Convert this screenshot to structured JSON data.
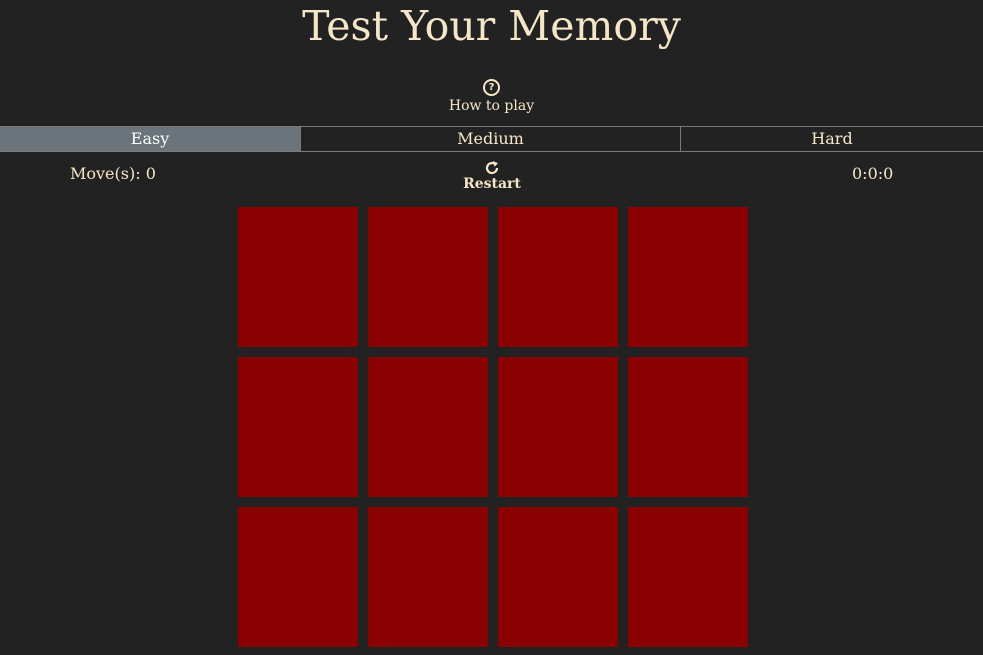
{
  "title": "Test Your Memory",
  "how_to_play": {
    "icon": "question-circle-icon",
    "label": "How to play"
  },
  "difficulty": {
    "tabs": [
      {
        "label": "Easy",
        "active": true
      },
      {
        "label": "Medium",
        "active": false
      },
      {
        "label": "Hard",
        "active": false
      }
    ]
  },
  "stats": {
    "moves_label": "Move(s): 0",
    "restart_label": "Restart",
    "restart_icon": "refresh-icon",
    "timer": "0:0:0"
  },
  "board": {
    "rows": 3,
    "cols": 4,
    "card_back_color": "#8b0000",
    "cards_face_down": 12
  },
  "colors": {
    "background": "#222222",
    "text": "#f5e6c8",
    "active_tab": "#6b737b",
    "card_back": "#8b0000"
  }
}
